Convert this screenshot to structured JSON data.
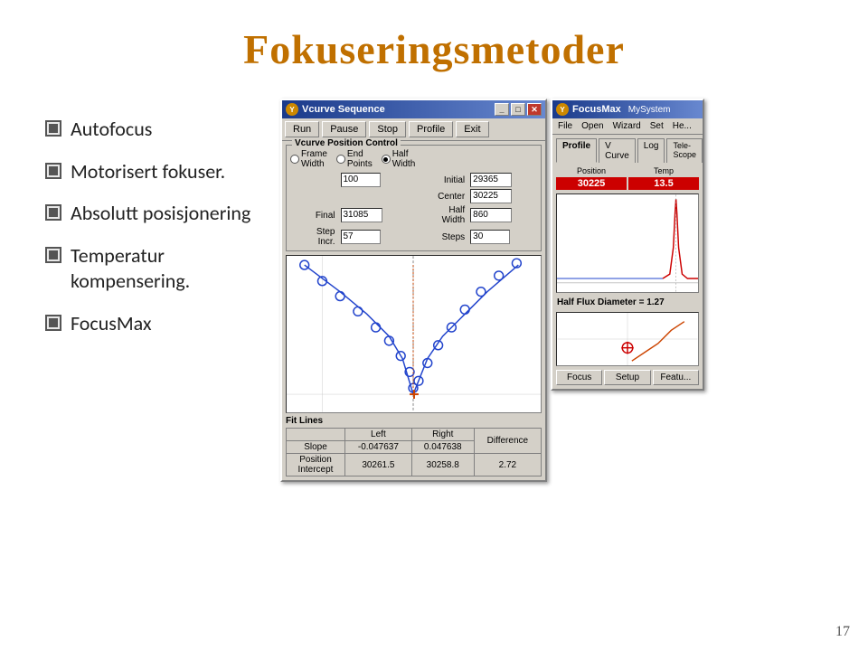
{
  "title": "Fokuseringsmetoder",
  "slide_number": "17",
  "bullets": [
    {
      "text": "Autofocus"
    },
    {
      "text": "Motorisert fokuser."
    },
    {
      "text": "Absolutt posisjonering"
    },
    {
      "text": "Temperatur kompensering."
    },
    {
      "text": "FocusMax"
    }
  ],
  "vcurve_window": {
    "title": "Vcurve Sequence",
    "toolbar": {
      "buttons": [
        "Run",
        "Pause",
        "Stop",
        "Profile",
        "Exit"
      ]
    },
    "group_label": "Vcurve Position Control",
    "radio_options": [
      "Frame Width",
      "End Points",
      "Half Width"
    ],
    "fields": {
      "frame_width": "100",
      "initial": "29365",
      "center": "30225",
      "final": "31085",
      "half_width": "860",
      "step_incr": "57",
      "steps": "30"
    },
    "fit_lines": {
      "header": "Fit Lines",
      "columns": [
        "",
        "Left",
        "Right"
      ],
      "rows": [
        {
          "label": "Slope",
          "left": "-0.047637",
          "right": "0.047638"
        },
        {
          "label": "Position Intercept",
          "left": "30261.5",
          "right": "30258.8"
        }
      ],
      "difference_label": "Difference",
      "difference_value": "2.72"
    }
  },
  "focusmax_window": {
    "title": "FocusMax",
    "system": "MySystem",
    "menu_items": [
      "File",
      "Open",
      "Wizard",
      "Set",
      "He..."
    ],
    "tabs": [
      "Profile",
      "V Curve",
      "Log",
      "Tele-Scope"
    ],
    "position_label": "Position",
    "temp_label": "Temp",
    "position_value": "30225",
    "temp_value": "13.5",
    "hfd_label": "Half Flux Diameter = 1.27",
    "buttons": [
      "Focus",
      "Setup",
      "Featu..."
    ]
  }
}
